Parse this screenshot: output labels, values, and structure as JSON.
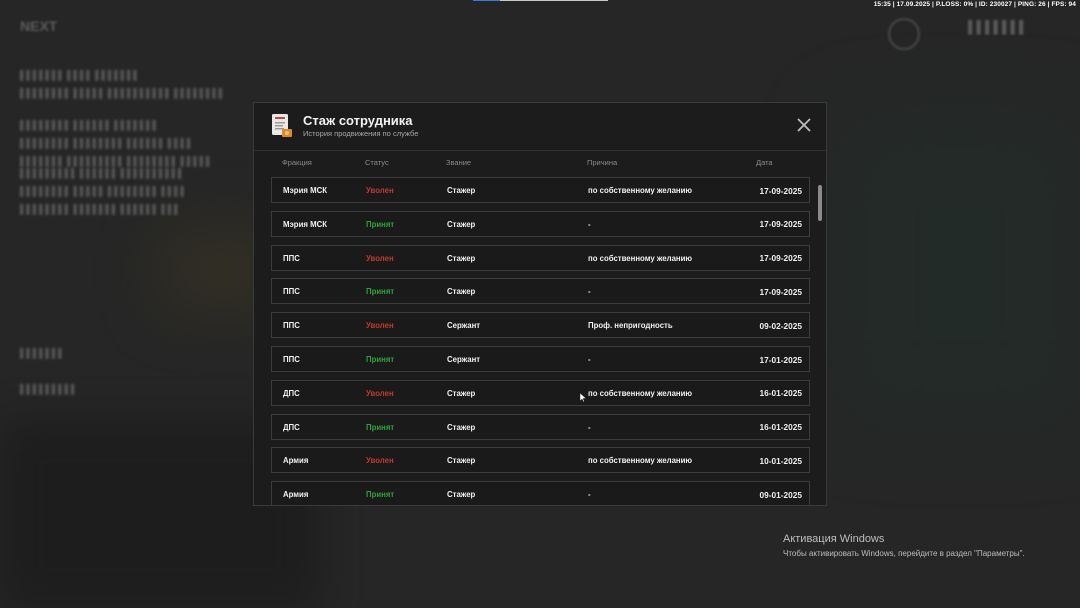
{
  "topbar": {
    "text": "15:35 | 17.09.2025 | P.LOSS: 0% | ID: 230027 | PING: 26 | FPS: 94"
  },
  "modal": {
    "title": "Стаж сотрудника",
    "subtitle": "История продвижения по службе",
    "columns": [
      "Фракция",
      "Статус",
      "Звание",
      "Причина",
      "Дата"
    ],
    "rows": [
      {
        "faction": "Мэрия МСК",
        "status": "Уволен",
        "status_type": "fired",
        "rank": "Стажер",
        "reason": "по собственному желанию",
        "date": "17-09-2025"
      },
      {
        "faction": "Мэрия МСК",
        "status": "Принят",
        "status_type": "hired",
        "rank": "Стажер",
        "reason": "-",
        "date": "17-09-2025"
      },
      {
        "faction": "ППС",
        "status": "Уволен",
        "status_type": "fired",
        "rank": "Стажер",
        "reason": "по собственному желанию",
        "date": "17-09-2025"
      },
      {
        "faction": "ППС",
        "status": "Принят",
        "status_type": "hired",
        "rank": "Стажер",
        "reason": "-",
        "date": "17-09-2025"
      },
      {
        "faction": "ППС",
        "status": "Уволен",
        "status_type": "fired",
        "rank": "Сержант",
        "reason": "Проф. непригодность",
        "date": "09-02-2025"
      },
      {
        "faction": "ППС",
        "status": "Принят",
        "status_type": "hired",
        "rank": "Сержант",
        "reason": "-",
        "date": "17-01-2025"
      },
      {
        "faction": "ДПС",
        "status": "Уволен",
        "status_type": "fired",
        "rank": "Стажер",
        "reason": "по собственному желанию",
        "date": "16-01-2025"
      },
      {
        "faction": "ДПС",
        "status": "Принят",
        "status_type": "hired",
        "rank": "Стажер",
        "reason": "-",
        "date": "16-01-2025"
      },
      {
        "faction": "Армия",
        "status": "Уволен",
        "status_type": "fired",
        "rank": "Стажер",
        "reason": "по собственному желанию",
        "date": "10-01-2025"
      },
      {
        "faction": "Армия",
        "status": "Принят",
        "status_type": "hired",
        "rank": "Стажер",
        "reason": "-",
        "date": "09-01-2025"
      }
    ]
  },
  "activation": {
    "title": "Активация Windows",
    "text": "Чтобы активировать Windows, перейдите в раздел \"Параметры\"."
  },
  "colors": {
    "fired": "#c0392f",
    "hired": "#2fa13b",
    "modal_bg": "#1c1c1c",
    "row_border": "#3c3c3c"
  },
  "icons": [
    "document-badge-icon",
    "close-icon",
    "mouse-cursor-icon"
  ]
}
